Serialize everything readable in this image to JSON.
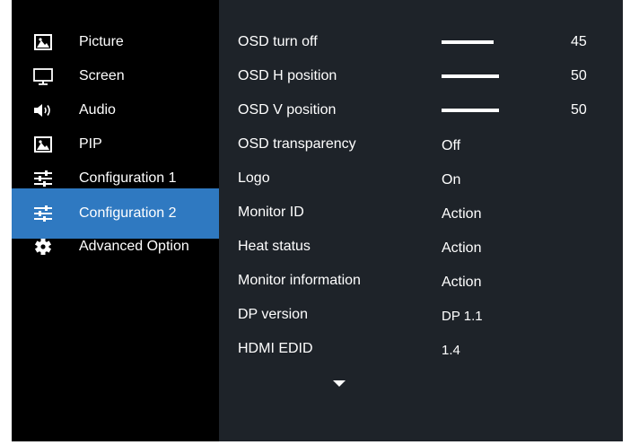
{
  "sidebar": {
    "items": [
      {
        "label": "Picture",
        "icon": "picture-icon"
      },
      {
        "label": "Screen",
        "icon": "monitor-icon"
      },
      {
        "label": "Audio",
        "icon": "speaker-icon"
      },
      {
        "label": "PIP",
        "icon": "picture-icon"
      },
      {
        "label": "Configuration 1",
        "icon": "sliders-icon"
      },
      {
        "label": "Configuration 2",
        "icon": "sliders-icon",
        "selected": true
      },
      {
        "label": "Advanced Option",
        "icon": "gear-icon"
      }
    ]
  },
  "settings": {
    "osd_turn_off": {
      "label": "OSD turn off",
      "value": "45",
      "level": 0.45
    },
    "osd_h_position": {
      "label": "OSD H position",
      "value": "50",
      "level": 0.5
    },
    "osd_v_position": {
      "label": "OSD V position",
      "value": "50",
      "level": 0.5
    },
    "osd_transparency": {
      "label": "OSD transparency",
      "value": "Off"
    },
    "logo": {
      "label": "Logo",
      "value": "On"
    },
    "monitor_id": {
      "label": "Monitor ID",
      "value": "Action"
    },
    "heat_status": {
      "label": "Heat status",
      "value": "Action"
    },
    "monitor_information": {
      "label": "Monitor information",
      "value": "Action"
    },
    "dp_version": {
      "label": "DP version",
      "value": "DP 1.1"
    },
    "hdmi_edid": {
      "label": "HDMI EDID",
      "value": "1.4"
    }
  },
  "scroll_indicator": {
    "icon": "chevron-down-icon"
  },
  "colors": {
    "sidebar_bg": "#000000",
    "panel_bg": "#1e2329",
    "selected_bg": "#2f79c1",
    "text": "#ffffff"
  }
}
